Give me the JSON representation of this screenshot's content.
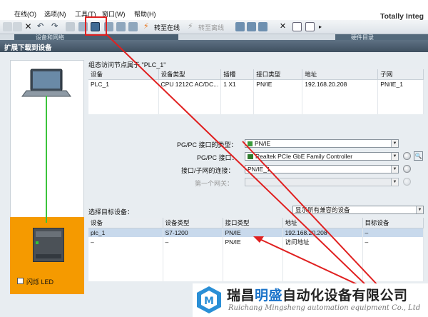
{
  "menubar": {
    "items": [
      "在线(O)",
      "选项(N)",
      "工具(T)",
      "窗口(W)",
      "帮助(H)"
    ],
    "brand": "Totally Integ"
  },
  "toolbar": {
    "go_online": "转至在线",
    "go_offline": "转至离线"
  },
  "behind": {
    "project_tab": "设备和网络",
    "right_tab": "硬件目录"
  },
  "dialog": {
    "title": "扩展下载到设备",
    "config_title": "组态访问节点属于 \"PLC_1\"",
    "config_table": {
      "headers": [
        "设备",
        "设备类型",
        "插槽",
        "接口类型",
        "地址",
        "子网"
      ],
      "row": [
        "PLC_1",
        "CPU 1212C AC/DC...",
        "1 X1",
        "PN/IE",
        "192.168.20.208",
        "PN/IE_1"
      ]
    },
    "pgpc_iface_type_label": "PG/PC 接口的类型：",
    "pgpc_iface_type_value": "PN/IE",
    "pgpc_iface_label": "PG/PC 接口：",
    "pgpc_iface_value": "Realtek PCIe GbE Family Controller",
    "conn_label": "接口/子网的连接：",
    "conn_value": "PN/IE_1",
    "gateway_label": "第一个网关：",
    "gateway_value": "",
    "target_title": "选择目标设备：",
    "filter_value": "显示所有兼容的设备",
    "target_table": {
      "headers": [
        "设备",
        "设备类型",
        "接口类型",
        "地址",
        "目标设备"
      ],
      "rows": [
        [
          "plc_1",
          "S7-1200",
          "PN/IE",
          "192.168.20.208",
          "–"
        ],
        [
          "–",
          "–",
          "PN/IE",
          "访问地址",
          "–"
        ]
      ]
    },
    "flash_led": "闪烁 LED"
  },
  "watermark": {
    "company_pre": "瑞昌",
    "company_highlight": "明盛",
    "company_post": "自动化设备有限公司",
    "english": "Ruichang Mingsheng automation equipment Co., Ltd"
  },
  "colors": {
    "accent_red": "#e02020",
    "network_green": "#3cc43c",
    "plc_orange": "#f59a00",
    "highlight_blue": "#1a73c9"
  }
}
